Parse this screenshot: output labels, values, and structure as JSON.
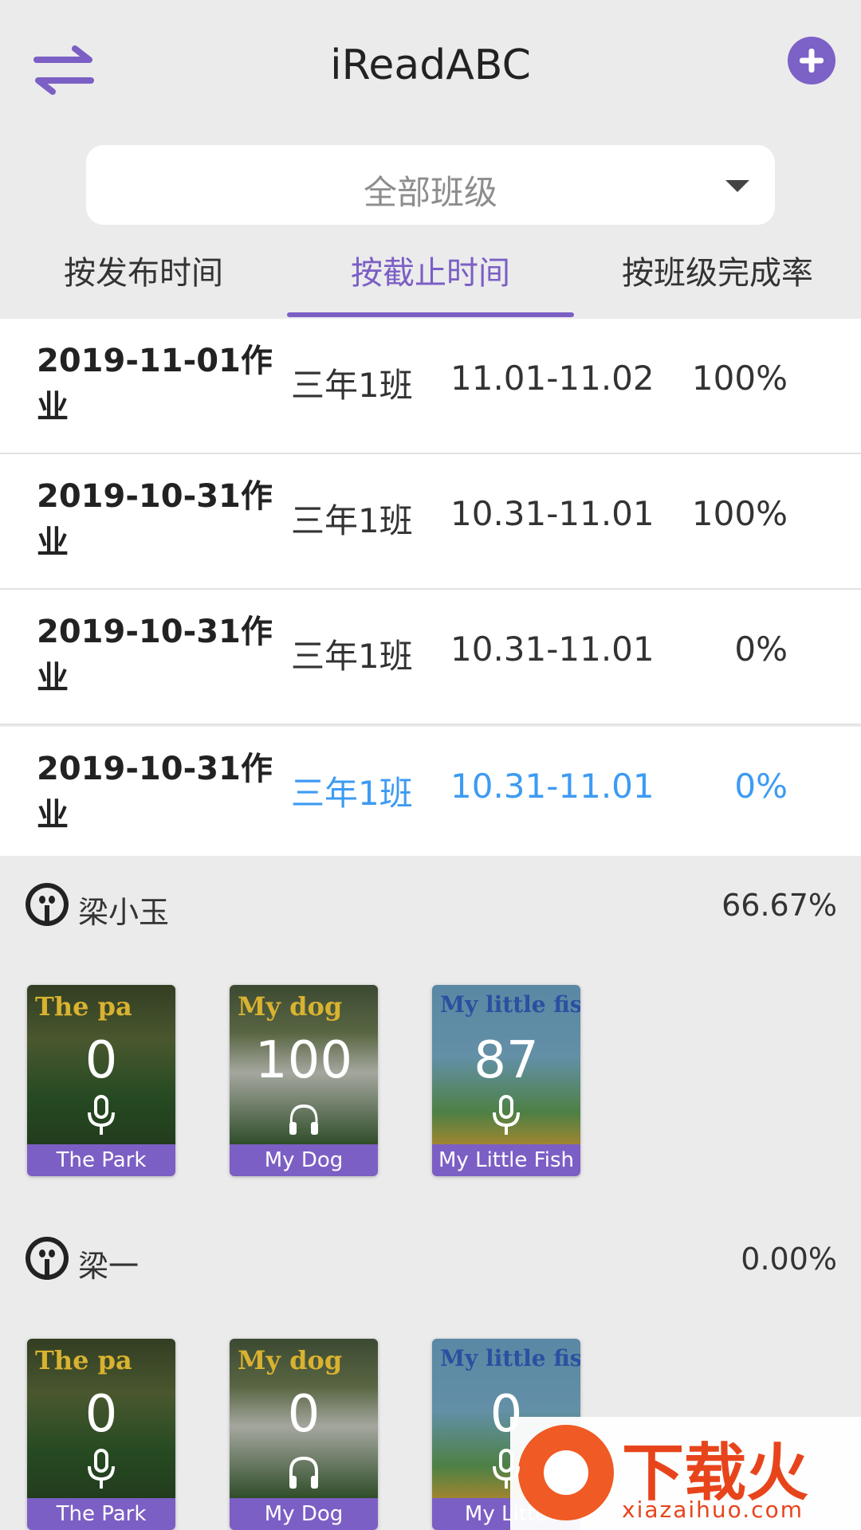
{
  "header": {
    "title": "iReadABC",
    "switch_icon": "swap-arrows-icon",
    "add_icon": "plus-circle-icon",
    "accent": "#7b5fc4"
  },
  "class_select": {
    "value": "全部班级",
    "icon": "dropdown-triangle-icon"
  },
  "tabs": [
    {
      "label": "按发布时间",
      "active": false
    },
    {
      "label": "按截止时间",
      "active": true
    },
    {
      "label": "按班级完成率",
      "active": false
    }
  ],
  "homework": [
    {
      "title": "2019-11-01作业",
      "class": "三年1班",
      "period": "11.01-11.02",
      "rate": "100%"
    },
    {
      "title": "2019-10-31作业",
      "class": "三年1班",
      "period": "10.31-11.01",
      "rate": "100%"
    },
    {
      "title": "2019-10-31作业",
      "class": "三年1班",
      "period": "10.31-11.01",
      "rate": "0%"
    },
    {
      "title": "2019-10-31作业",
      "class": "三年1班",
      "period": "10.31-11.01",
      "rate": "0%",
      "selected": true
    }
  ],
  "students": [
    {
      "name": "梁小玉",
      "rate": "66.67%",
      "books": [
        {
          "heading": "The pa",
          "score": "0",
          "label": "The Park",
          "icon": "microphone-icon"
        },
        {
          "heading": "My dog",
          "score": "100",
          "label": "My Dog",
          "icon": "headphones-icon"
        },
        {
          "heading": "My little fis",
          "score": "87",
          "label": "My Little Fish",
          "icon": "microphone-icon"
        }
      ]
    },
    {
      "name": "梁一",
      "rate": "0.00%",
      "books": [
        {
          "heading": "The pa",
          "score": "0",
          "label": "The Park",
          "icon": "microphone-icon"
        },
        {
          "heading": "My dog",
          "score": "0",
          "label": "My Dog",
          "icon": "headphones-icon"
        },
        {
          "heading": "My little fis",
          "score": "0",
          "label": "My Litte",
          "icon": "microphone-icon"
        }
      ]
    }
  ],
  "watermark": {
    "text": "下载火",
    "url": "xiazaihuo.com"
  },
  "colors": {
    "selected_text": "#3d9bf3",
    "book_label_bg": "#7c5fc4"
  }
}
